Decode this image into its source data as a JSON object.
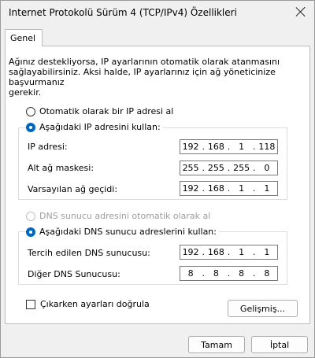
{
  "window": {
    "title": "Internet Protokolü Sürüm 4 (TCP/IPv4) Özellikleri"
  },
  "tabs": [
    {
      "label": "Genel"
    }
  ],
  "description": "Ağınız destekliyorsa, IP ayarlarının otomatik olarak atanmasını\nsağlayabilirsiniz. Aksi halde, IP ayarlarınız için ağ yöneticinize başvurmanız\ngerekir.",
  "ip_section": {
    "auto_label": "Otomatik olarak bir IP adresi al",
    "manual_label": "Aşağıdaki IP adresini kullan:",
    "fields": [
      {
        "label": "IP adresi:",
        "octets": [
          "192",
          "168",
          "1",
          "118"
        ]
      },
      {
        "label": "Alt ağ maskesi:",
        "octets": [
          "255",
          "255",
          "255",
          "0"
        ]
      },
      {
        "label": "Varsayılan ağ geçidi:",
        "octets": [
          "192",
          "168",
          "1",
          "1"
        ]
      }
    ]
  },
  "dns_section": {
    "auto_label": "DNS sunucu adresini otomatik olarak al",
    "manual_label": "Aşağıdaki DNS sunucu adreslerini kullan:",
    "fields": [
      {
        "label": "Tercih edilen DNS sunucusu:",
        "octets": [
          "192",
          "168",
          "1",
          "1"
        ]
      },
      {
        "label": "Diğer DNS Sunucusu:",
        "octets": [
          "8",
          "8",
          "8",
          "8"
        ]
      }
    ]
  },
  "validate_label": "Çıkarken ayarları doğrula",
  "buttons": {
    "advanced": "Gelişmiş...",
    "ok": "Tamam",
    "cancel": "İptal"
  }
}
